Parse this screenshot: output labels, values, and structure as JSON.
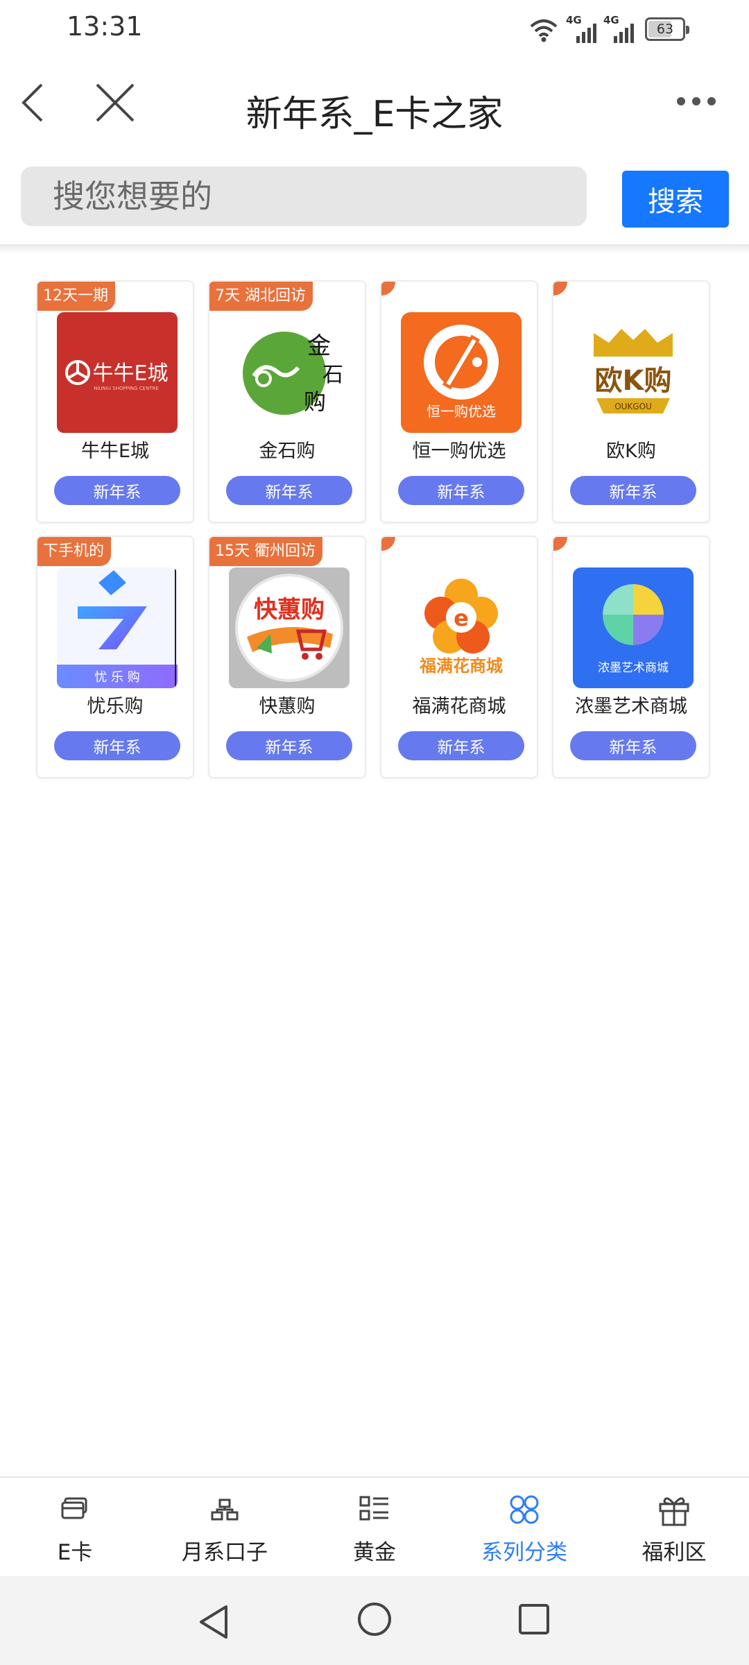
{
  "status_bar": {
    "time": "13:31",
    "network1": "4G",
    "network2": "4G",
    "battery": "63"
  },
  "header": {
    "title": "新年系_E卡之家",
    "back_icon": "back-arrow-icon",
    "close_icon": "close-icon",
    "more_icon": "more-dots-icon"
  },
  "search": {
    "placeholder": "搜您想要的",
    "button_label": "搜索"
  },
  "cards": [
    {
      "tag": "12天一期",
      "name": "牛牛E城",
      "button": "新年系",
      "logo_text": "牛牛E城",
      "logo_sub": "NIUNIU SHOPPING CENTRE"
    },
    {
      "tag": "7天 湖北回访",
      "name": "金石购",
      "button": "新年系",
      "logo_text": "金石购"
    },
    {
      "tag": "",
      "name": "恒一购优选",
      "button": "新年系",
      "logo_text": "恒一购优选"
    },
    {
      "tag": "",
      "name": "欧K购",
      "button": "新年系",
      "logo_text": "欧K购",
      "logo_sub": "OUKGOU"
    },
    {
      "tag": "下手机的",
      "name": "忧乐购",
      "button": "新年系",
      "logo_text": "忧 乐 购"
    },
    {
      "tag": "15天 衢州回访",
      "name": "快蕙购",
      "button": "新年系",
      "logo_text": "快蕙购"
    },
    {
      "tag": "",
      "name": "福满花商城",
      "button": "新年系",
      "logo_text": "福满花商城"
    },
    {
      "tag": "",
      "name": "浓墨艺术商城",
      "button": "新年系",
      "logo_text": "浓墨艺术商城"
    }
  ],
  "bottom_nav": [
    {
      "label": "E卡",
      "icon": "card-icon",
      "active": false
    },
    {
      "label": "月系口子",
      "icon": "hierarchy-icon",
      "active": false
    },
    {
      "label": "黄金",
      "icon": "list-icon",
      "active": false
    },
    {
      "label": "系列分类",
      "icon": "category-icon",
      "active": true
    },
    {
      "label": "福利区",
      "icon": "gift-icon",
      "active": false
    }
  ],
  "colors": {
    "accent": "#1677ff",
    "card_button": "#6679ee",
    "tag": "#e8713c",
    "active_nav": "#2d7ef7"
  }
}
